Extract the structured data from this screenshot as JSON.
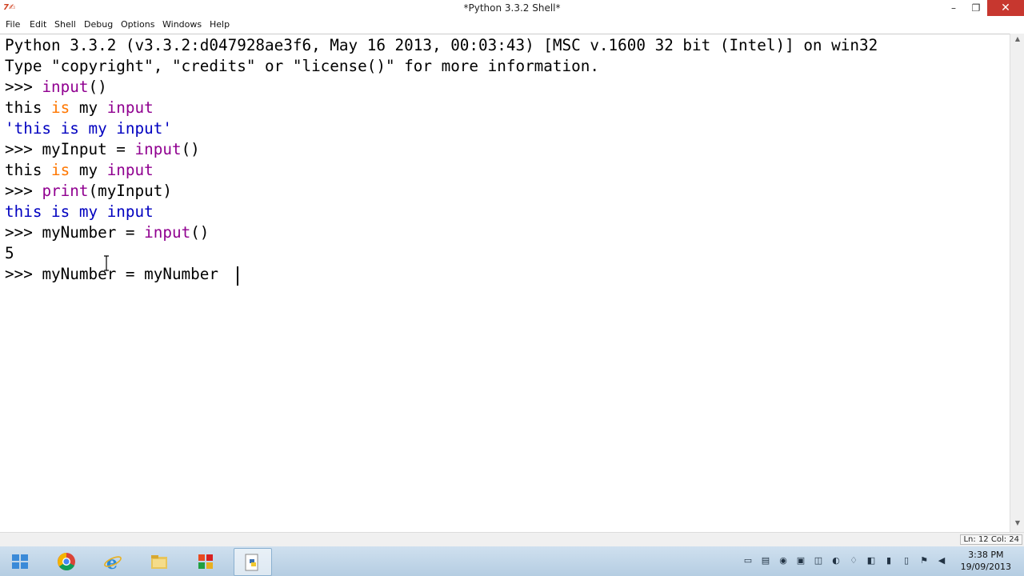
{
  "window": {
    "title": "*Python 3.3.2 Shell*",
    "app_icon_label": "7✍",
    "minimize": "–",
    "maximize": "❐",
    "close": "✕"
  },
  "menu": [
    "File",
    "Edit",
    "Shell",
    "Debug",
    "Options",
    "Windows",
    "Help"
  ],
  "shell": {
    "banner1": "Python 3.3.2 (v3.3.2:d047928ae3f6, May 16 2013, 00:03:43) [MSC v.1600 32 bit (Intel)] on win32",
    "banner2": "Type \"copyright\", \"credits\" or \"license()\" for more information.",
    "prompt": ">>> ",
    "l3_fn": "input",
    "l3_rest": "()",
    "l4_a": "this ",
    "l4_kw": "is",
    "l4_b": " my ",
    "l4_fn": "input",
    "l5": "'this is my input'",
    "l6_a": "myInput = ",
    "l6_fn": "input",
    "l6_b": "()",
    "l7_a": "this ",
    "l7_kw": "is",
    "l7_b": " my ",
    "l7_fn": "input",
    "l8_fn": "print",
    "l8_b": "(myInput)",
    "l9": "this is my input",
    "l10_a": "myNumber = ",
    "l10_fn": "input",
    "l10_b": "()",
    "l11": "5",
    "l12": "myNumber = myNumber "
  },
  "status": {
    "position": "Ln: 12 Col: 24"
  },
  "clock": {
    "time": "3:38 PM",
    "date": "19/09/2013"
  },
  "colors": {
    "builtin": "#900090",
    "keyword": "#ff7700",
    "output": "#0000c0",
    "close": "#c7372f"
  }
}
